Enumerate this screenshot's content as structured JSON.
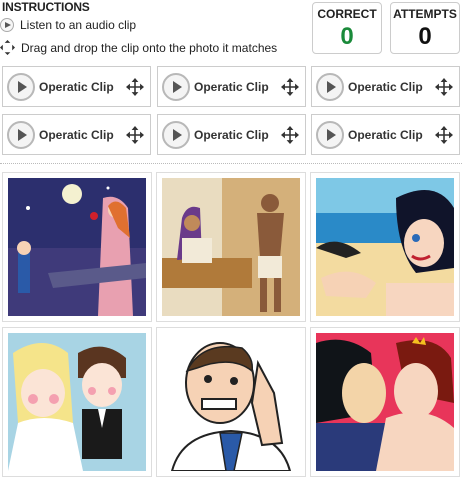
{
  "instructions": {
    "title": "INSTRUCTIONS",
    "step1": "Listen to an audio clip",
    "step2": "Drag and drop the clip onto the photo it matches"
  },
  "score": {
    "correct_label": "CORRECT",
    "correct_value": "0",
    "attempts_label": "ATTEMPTS",
    "attempts_value": "0",
    "correct_color": "#1a8a3a"
  },
  "clips": [
    {
      "label": "Operatic Clip"
    },
    {
      "label": "Operatic Clip"
    },
    {
      "label": "Operatic Clip"
    },
    {
      "label": "Operatic Clip"
    },
    {
      "label": "Operatic Clip"
    },
    {
      "label": "Operatic Clip"
    }
  ],
  "photos": [
    {
      "subject": "balcony-serenade-cartoon"
    },
    {
      "subject": "egyptian-couple-cartoon"
    },
    {
      "subject": "crying-woman-beach-comic"
    },
    {
      "subject": "wedding-couple-cartoon"
    },
    {
      "subject": "confused-man-pointing-head"
    },
    {
      "subject": "kissing-couple-comic"
    }
  ]
}
